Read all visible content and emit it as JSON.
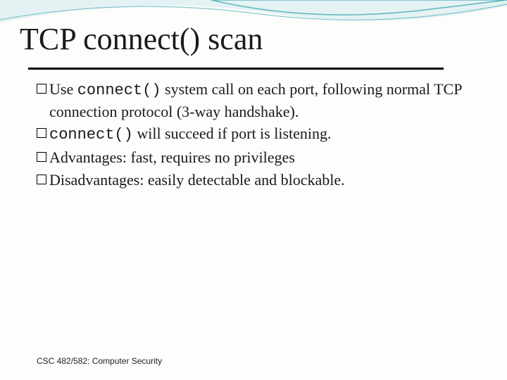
{
  "slide": {
    "title": "TCP connect() scan",
    "bullets": [
      {
        "parts": [
          {
            "text": "Use ",
            "mono": false
          },
          {
            "text": "connect()",
            "mono": true
          },
          {
            "text": " system call on each port, following normal TCP connection protocol (3-way handshake).",
            "mono": false
          }
        ]
      },
      {
        "parts": [
          {
            "text": "connect()",
            "mono": true
          },
          {
            "text": " will succeed if port is listening.",
            "mono": false
          }
        ]
      },
      {
        "parts": [
          {
            "text": "Advantages: fast, requires no privileges",
            "mono": false
          }
        ]
      },
      {
        "parts": [
          {
            "text": "Disadvantages: easily detectable and blockable.",
            "mono": false
          }
        ]
      }
    ],
    "footer": "CSC 482/582: Computer Security"
  }
}
